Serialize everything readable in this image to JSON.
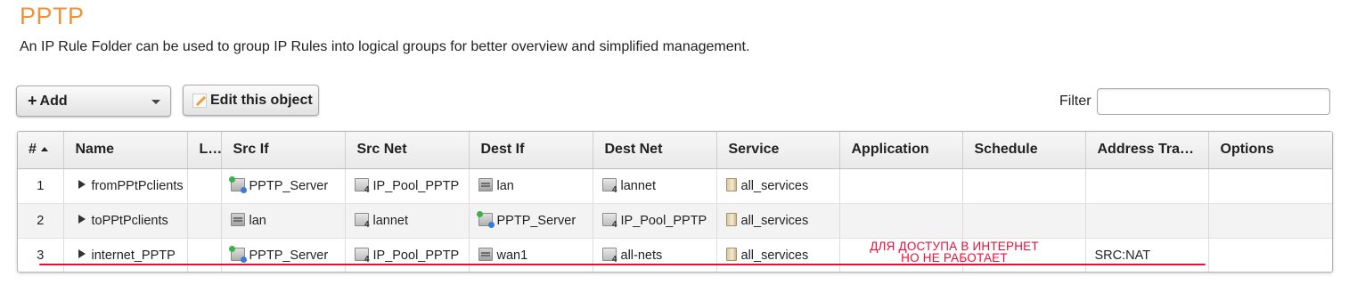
{
  "page": {
    "title": "PPTP",
    "description": "An IP Rule Folder can be used to group IP Rules into logical groups for better overview and simplified management."
  },
  "toolbar": {
    "add_label": "Add",
    "add_icon": "plus-icon",
    "edit_label": "Edit this object",
    "edit_icon": "pencil-icon",
    "filter_label": "Filter",
    "filter_value": ""
  },
  "table": {
    "columns": [
      "#",
      "Name",
      "L…",
      "Src If",
      "Src Net",
      "Dest If",
      "Dest Net",
      "Service",
      "Application",
      "Schedule",
      "Address Tran…",
      "Options"
    ],
    "sorted_column": "#",
    "sort_direction": "ascending",
    "rows": [
      {
        "num": "1",
        "name": "fromPPtPclients",
        "log": "",
        "src_if": "PPTP_Server",
        "src_net": "IP_Pool_PPTP",
        "dest_if": "lan",
        "dest_net": "lannet",
        "service": "all_services",
        "application": "",
        "schedule": "",
        "address_translation": "",
        "options": ""
      },
      {
        "num": "2",
        "name": "toPPtPclients",
        "log": "",
        "src_if": "lan",
        "src_net": "lannet",
        "dest_if": "PPTP_Server",
        "dest_net": "IP_Pool_PPTP",
        "service": "all_services",
        "application": "",
        "schedule": "",
        "address_translation": "",
        "options": ""
      },
      {
        "num": "3",
        "name": "internet_PPTP",
        "log": "",
        "src_if": "PPTP_Server",
        "src_net": "IP_Pool_PPTP",
        "dest_if": "wan1",
        "dest_net": "all-nets",
        "service": "all_services",
        "application": "",
        "schedule": "",
        "address_translation": "SRC:NAT",
        "options": ""
      }
    ]
  },
  "annotation": {
    "line1": "ДЛЯ ДОСТУПА В ИНТЕРНЕТ",
    "line2": "НО НЕ РАБОТАЕТ",
    "color": "#e8103a"
  },
  "colors": {
    "title": "#f0923a",
    "alt_row": "#f3f3f3"
  }
}
